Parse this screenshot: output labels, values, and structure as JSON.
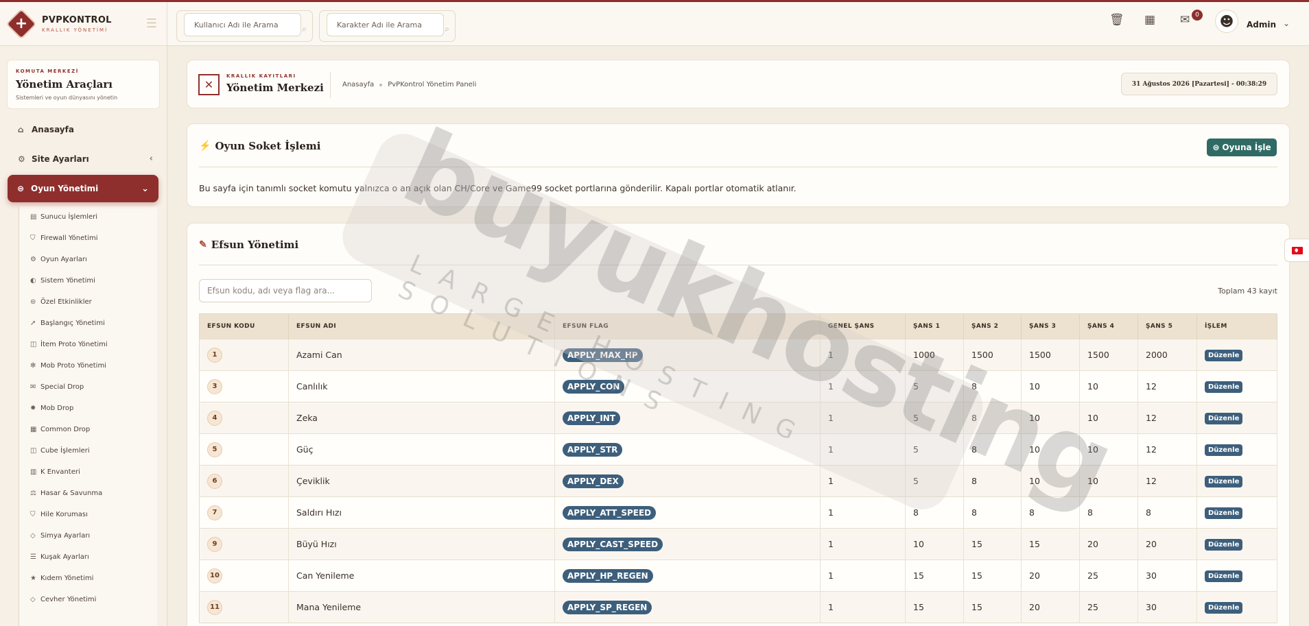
{
  "brand": {
    "name": "PVPKONTROL",
    "subtitle": "KRALLIK YÖNETİMİ"
  },
  "sidebar": {
    "card": {
      "kicker": "KOMUTA MERKEZİ",
      "title": "Yönetim Araçları",
      "subtitle": "Sistemleri ve oyun dünyasını yönetin"
    },
    "items": [
      {
        "label": "Anasayfa",
        "icon": "home-icon"
      },
      {
        "label": "Site Ayarları",
        "icon": "gear-icon"
      },
      {
        "label": "Oyun Yönetimi",
        "icon": "gamepad-icon"
      }
    ],
    "sub_items": [
      {
        "label": "Sunucu İşlemleri",
        "icon": "server-icon"
      },
      {
        "label": "Firewall Yönetimi",
        "icon": "shield-icon"
      },
      {
        "label": "Oyun Ayarları",
        "icon": "gears-icon"
      },
      {
        "label": "Sistem Yönetimi",
        "icon": "toggle-icon"
      },
      {
        "label": "Özel Etkinlikler",
        "icon": "gamepad-icon"
      },
      {
        "label": "Başlangıç Yönetimi",
        "icon": "rocket-icon"
      },
      {
        "label": "İtem Proto Yönetimi",
        "icon": "cube-icon"
      },
      {
        "label": "Mob Proto Yönetimi",
        "icon": "paw-icon"
      },
      {
        "label": "Special Drop",
        "icon": "gift-icon"
      },
      {
        "label": "Mob Drop",
        "icon": "bug-icon"
      },
      {
        "label": "Common Drop",
        "icon": "grid-icon"
      },
      {
        "label": "Cube İşlemleri",
        "icon": "cube-icon"
      },
      {
        "label": "K Envanteri",
        "icon": "table-icon"
      },
      {
        "label": "Hasar & Savunma",
        "icon": "scale-icon"
      },
      {
        "label": "Hile Koruması",
        "icon": "shield-icon"
      },
      {
        "label": "Simya Ayarları",
        "icon": "gem-icon"
      },
      {
        "label": "Kuşak Ayarları",
        "icon": "sliders-icon"
      },
      {
        "label": "Kıdem Yönetimi",
        "icon": "star-icon"
      },
      {
        "label": "Cevher Yönetimi",
        "icon": "gem-icon"
      }
    ]
  },
  "header": {
    "user_search_placeholder": "Kullanıcı Adı ile Arama",
    "char_search_placeholder": "Karakter Adı ile Arama",
    "mail_count": "0",
    "admin_name": "Admin"
  },
  "breadcrumb": {
    "kicker": "KRALLIK KAYITLARI",
    "title": "Yönetim Merkezi",
    "home": "Anasayfa",
    "current": "PvPKontrol Yönetim Paneli",
    "datetime": "31 Ağustos 2026 [Pazartesi] - 00:38:29"
  },
  "socket": {
    "title": "Oyun Soket İşlemi",
    "button": "Oyuna İşle",
    "description": "Bu sayfa için tanımlı socket komutu yalnızca o an açık olan CH/Core ve Game99 socket portlarına gönderilir. Kapalı portlar otomatik atlanır."
  },
  "efsun": {
    "title": "Efsun Yönetimi",
    "search_placeholder": "Efsun kodu, adı veya flag ara...",
    "total": "Toplam 43 kayıt",
    "columns": [
      "EFSUN KODU",
      "EFSUN ADI",
      "EFSUN FLAG",
      "GENEL ŞANS",
      "ŞANS 1",
      "ŞANS 2",
      "ŞANS 3",
      "ŞANS 4",
      "ŞANS 5",
      "İŞLEM"
    ],
    "edit_label": "Düzenle",
    "rows": [
      {
        "code": "1",
        "name": "Azami Can",
        "flag": "APPLY_MAX_HP",
        "general": "1",
        "c1": "1000",
        "c2": "1500",
        "c3": "1500",
        "c4": "1500",
        "c5": "2000"
      },
      {
        "code": "3",
        "name": "Canlılık",
        "flag": "APPLY_CON",
        "general": "1",
        "c1": "5",
        "c2": "8",
        "c3": "10",
        "c4": "10",
        "c5": "12"
      },
      {
        "code": "4",
        "name": "Zeka",
        "flag": "APPLY_INT",
        "general": "1",
        "c1": "5",
        "c2": "8",
        "c3": "10",
        "c4": "10",
        "c5": "12"
      },
      {
        "code": "5",
        "name": "Güç",
        "flag": "APPLY_STR",
        "general": "1",
        "c1": "5",
        "c2": "8",
        "c3": "10",
        "c4": "10",
        "c5": "12"
      },
      {
        "code": "6",
        "name": "Çeviklik",
        "flag": "APPLY_DEX",
        "general": "1",
        "c1": "5",
        "c2": "8",
        "c3": "10",
        "c4": "10",
        "c5": "12"
      },
      {
        "code": "7",
        "name": "Saldırı Hızı",
        "flag": "APPLY_ATT_SPEED",
        "general": "1",
        "c1": "8",
        "c2": "8",
        "c3": "8",
        "c4": "8",
        "c5": "8"
      },
      {
        "code": "9",
        "name": "Büyü Hızı",
        "flag": "APPLY_CAST_SPEED",
        "general": "1",
        "c1": "10",
        "c2": "15",
        "c3": "15",
        "c4": "20",
        "c5": "20"
      },
      {
        "code": "10",
        "name": "Can Yenileme",
        "flag": "APPLY_HP_REGEN",
        "general": "1",
        "c1": "15",
        "c2": "15",
        "c3": "20",
        "c4": "25",
        "c5": "30"
      },
      {
        "code": "11",
        "name": "Mana Yenileme",
        "flag": "APPLY_SP_REGEN",
        "general": "1",
        "c1": "15",
        "c2": "15",
        "c3": "20",
        "c4": "25",
        "c5": "30"
      }
    ]
  },
  "watermark": {
    "big": "buyukhosting",
    "small": "LARGE HOSTING SOLUTIONS"
  }
}
